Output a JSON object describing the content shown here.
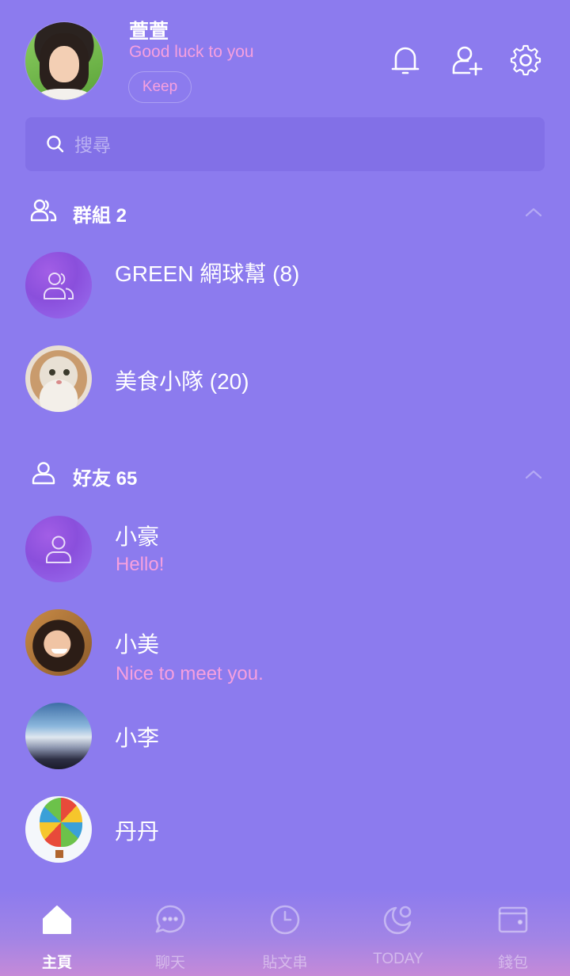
{
  "profile": {
    "name": "萱萱",
    "status": "Good luck to you",
    "keep_label": "Keep"
  },
  "header_icons": [
    "bell-icon",
    "add-friend-icon",
    "settings-icon"
  ],
  "search": {
    "placeholder": "搜尋",
    "value": ""
  },
  "groups": {
    "label": "群組 2",
    "items": [
      {
        "name": "GREEN 網球幫 (8)",
        "avatar": "default-group-icon"
      },
      {
        "name": "美食小隊 (20)",
        "avatar": "cat-photo"
      }
    ]
  },
  "friends": {
    "label": "好友 65",
    "items": [
      {
        "name": "小豪",
        "message": "Hello!",
        "avatar": "default-user-icon"
      },
      {
        "name": "小美",
        "message": "Nice to meet you.",
        "avatar": "woman-photo"
      },
      {
        "name": "小李",
        "message": "",
        "avatar": "sky-photo"
      },
      {
        "name": "丹丹",
        "message": "",
        "avatar": "balloon-photo"
      }
    ]
  },
  "nav": {
    "items": [
      {
        "label": "主頁",
        "icon": "home-icon",
        "active": true
      },
      {
        "label": "聊天",
        "icon": "chat-icon",
        "active": false
      },
      {
        "label": "貼文串",
        "icon": "clock-icon",
        "active": false
      },
      {
        "label": "TODAY",
        "icon": "today-icon",
        "active": false
      },
      {
        "label": "錢包",
        "icon": "wallet-icon",
        "active": false
      }
    ]
  },
  "colors": {
    "background": "#8c7bee",
    "accent_pink": "#f6a0df",
    "search_bg": "#8270e7"
  }
}
